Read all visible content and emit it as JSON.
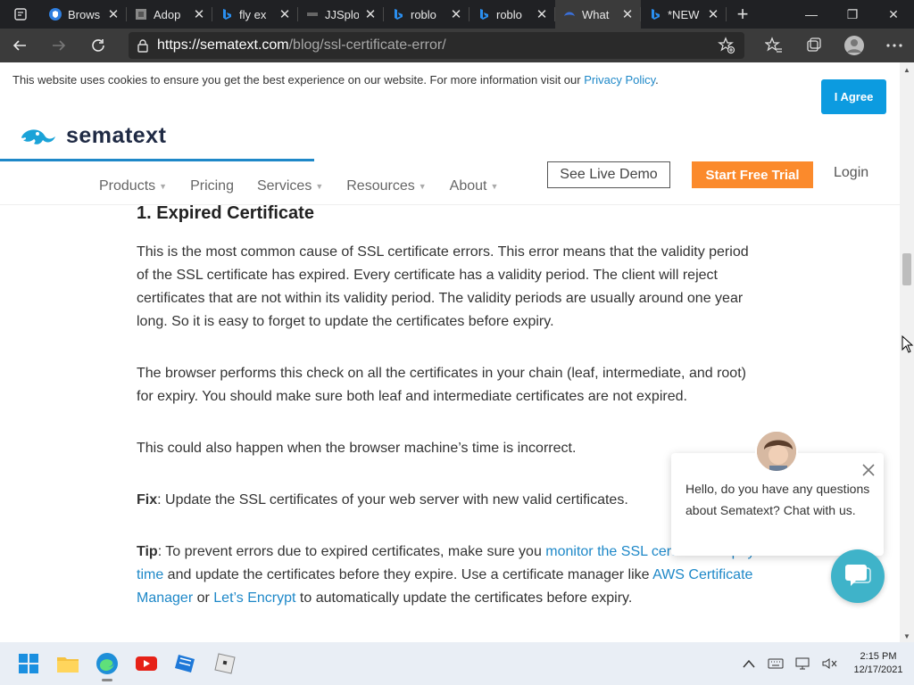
{
  "browser": {
    "tabs": [
      {
        "title": "Brows",
        "icon": "edge-shield-icon"
      },
      {
        "title": "Adop",
        "icon": "document-icon"
      },
      {
        "title": "fly ex",
        "icon": "bing-icon"
      },
      {
        "title": "JJSplo",
        "icon": "site-icon"
      },
      {
        "title": "roblo",
        "icon": "bing-icon"
      },
      {
        "title": "roblo",
        "icon": "bing-icon"
      },
      {
        "title": "What",
        "icon": "sematext-icon"
      },
      {
        "title": "*NEW",
        "icon": "bing-icon"
      }
    ],
    "url_host": "https://sematext.com",
    "url_path": "/blog/ssl-certificate-error/"
  },
  "cookie": {
    "text": "This website uses cookies to ensure you get the best experience on our website. For more information visit our ",
    "link": "Privacy Policy",
    "end": ".",
    "button": "I Agree"
  },
  "header": {
    "logo": "sematext",
    "nav": [
      {
        "label": "Products",
        "caret": true
      },
      {
        "label": "Pricing",
        "caret": false
      },
      {
        "label": "Services",
        "caret": true
      },
      {
        "label": "Resources",
        "caret": true
      },
      {
        "label": "About",
        "caret": true
      }
    ],
    "demo": "See Live Demo",
    "trial": "Start Free Trial",
    "login": "Login"
  },
  "article": {
    "heading": "1. Expired Certificate",
    "p1": "This is the most common cause of SSL certificate errors. This error means that the validity period of the SSL certificate has expired. Every certificate has a validity period. The client will reject certificates that are not within its validity period. The validity periods are usually around one year long. So it is easy to forget to update the certificates before expiry.",
    "p2": "The browser performs this check on all the certificates in your chain (leaf, intermediate, and root) for expiry. You should make sure both leaf and intermediate certificates are not expired.",
    "p3": "This could also happen when the browser machine’s time is incorrect.",
    "fix_label": "Fix",
    "fix_text": ": Update the SSL certificates of your web server with new valid certificates.",
    "tip_label": "Tip",
    "tip_a": ": To prevent errors due to expired certificates, make sure you ",
    "tip_link1": "monitor the SSL certificate expiry time",
    "tip_b": " and update the certificates before they expire. Use a certificate manager like ",
    "tip_link2": "AWS Certificate Manager",
    "tip_c": " or ",
    "tip_link3": "Let’s Encrypt",
    "tip_d": " to automatically update the certificates before expiry."
  },
  "chat": {
    "message": "Hello, do you have any questions about Sematext? Chat with us."
  },
  "taskbar": {
    "time": "2:15 PM",
    "date": "12/17/2021"
  },
  "colors": {
    "accent_blue": "#1e88c8",
    "trial_orange": "#fb8a2c",
    "chat_teal": "#3fb3c9"
  }
}
